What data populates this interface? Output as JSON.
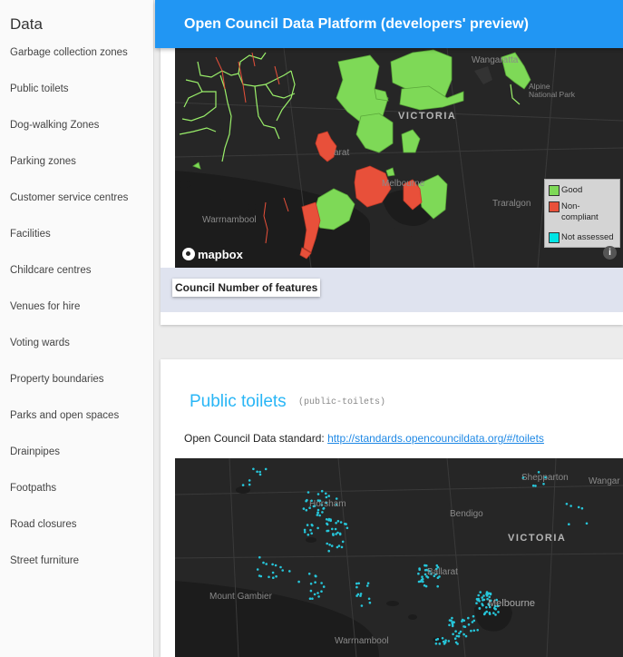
{
  "sidebar": {
    "title": "Data",
    "items": [
      "Garbage collection zones",
      "Public toilets",
      "Dog-walking Zones",
      "Parking zones",
      "Customer service centres",
      "Facilities",
      "Childcare centres",
      "Venues for hire",
      "Voting wards",
      "Property boundaries",
      "Parks and open spaces",
      "Drainpipes",
      "Footpaths",
      "Road closures",
      "Street furniture"
    ]
  },
  "header": {
    "title": "Open Council Data Platform (developers' preview)"
  },
  "map1": {
    "labels": {
      "wangaratta": "Wangaratta",
      "victoria": "VICTORIA",
      "alpine": "Alpine\nNational Park",
      "melbourne": "Melbourne",
      "traralgon": "Traralgon",
      "warrnambool": "Warrnambool",
      "ballarat": "arat"
    },
    "legend": {
      "good": "Good",
      "noncompliant": "Non-compliant",
      "notassessed": "Not assessed"
    },
    "colors": {
      "good": "#7ed957",
      "noncompliant": "#e8503a",
      "notassessed": "#00e5e5"
    },
    "attribution": "mapbox",
    "info_icon": "info-icon"
  },
  "properties_label": "Council Number of features",
  "section": {
    "title": "Public toilets",
    "id": "(public-toilets)",
    "standard_prefix": "Open Council Data standard:",
    "standard_link": "http://standards.opencouncildata.org/#/toilets"
  },
  "map2": {
    "labels": {
      "shepparton": "Shepparton",
      "wangaratta": "Wangar",
      "bendigo": "Bendigo",
      "victoria": "VICTORIA",
      "horsham": "Horsham",
      "ballarat": "Ballarat",
      "mountgambier": "Mount Gambier",
      "melbourne": "Melbourne",
      "warrnambool": "Warrnambool"
    },
    "point_color": "#26c6da"
  }
}
